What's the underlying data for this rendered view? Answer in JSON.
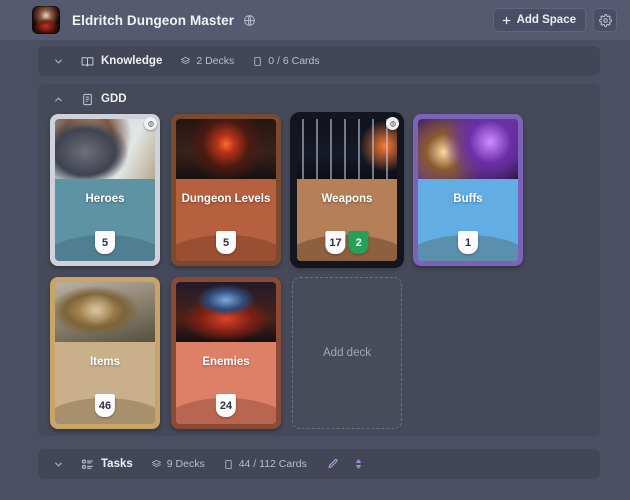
{
  "topbar": {
    "avatar_name": "avatar",
    "title": "Eldritch Dungeon Master",
    "globe_icon": "globe-icon",
    "add_space_label": "Add Space",
    "settings_icon": "gear-icon"
  },
  "sections": {
    "knowledge": {
      "label": "Knowledge",
      "icon": "book-icon",
      "decks": "2 Decks",
      "cards": "0 / 6 Cards",
      "collapsed": true
    },
    "gdd": {
      "label": "GDD",
      "icon": "document-icon",
      "collapsed": false
    },
    "tasks": {
      "label": "Tasks",
      "icon": "kanban-icon",
      "decks": "9 Decks",
      "cards": "44 / 112 Cards",
      "edit_icon": "pencil-icon",
      "sort_icon": "sort-updown-icon",
      "collapsed": true
    }
  },
  "decks": [
    {
      "title": "Heroes",
      "badges": [
        {
          "value": "5",
          "style": "white"
        }
      ],
      "corner_badge": "disc-icon",
      "body_color": "#5e93a4",
      "arc_color": "#4f7f90",
      "frame_color": "#cfd2d8",
      "art": "hero-warrior-art"
    },
    {
      "title": "Dungeon Levels",
      "badges": [
        {
          "value": "5",
          "style": "white"
        }
      ],
      "corner_badge": null,
      "body_color": "#b5603f",
      "arc_color": "#9a4f33",
      "frame_color": "#7a4a30",
      "art": "dungeon-portal-art"
    },
    {
      "title": "Weapons",
      "badges": [
        {
          "value": "17",
          "style": "white"
        },
        {
          "value": "2",
          "style": "green"
        }
      ],
      "corner_badge": "disc-icon",
      "body_color": "#b57f57",
      "arc_color": "#8d6140",
      "frame_color": "#14161f",
      "selected": true,
      "art": "weapons-swords-art"
    },
    {
      "title": "Buffs",
      "badges": [
        {
          "value": "1",
          "style": "white"
        }
      ],
      "corner_badge": null,
      "body_color": "#62aee4",
      "arc_color": "#5b8fae",
      "frame_color": "#7d63b8",
      "art": "buffs-wizard-art"
    },
    {
      "title": "Items",
      "badges": [
        {
          "value": "46",
          "style": "white"
        }
      ],
      "corner_badge": null,
      "body_color": "#c9b08a",
      "arc_color": "#a8906d",
      "frame_color": "#c8a567",
      "art": "items-ring-art"
    },
    {
      "title": "Enemies",
      "badges": [
        {
          "value": "24",
          "style": "white"
        }
      ],
      "corner_badge": null,
      "body_color": "#dc8168",
      "arc_color": "#b96650",
      "frame_color": "#8a4a35",
      "art": "enemies-spider-art"
    }
  ],
  "add_deck": {
    "label": "Add deck"
  },
  "colors": {
    "page_bg": "#4b4f63",
    "topbar_bg": "#565a70",
    "section_bg": "#424657",
    "panel_bg": "#454959",
    "accent_green": "#25a05a",
    "accent_purple": "#b9a2e8"
  }
}
